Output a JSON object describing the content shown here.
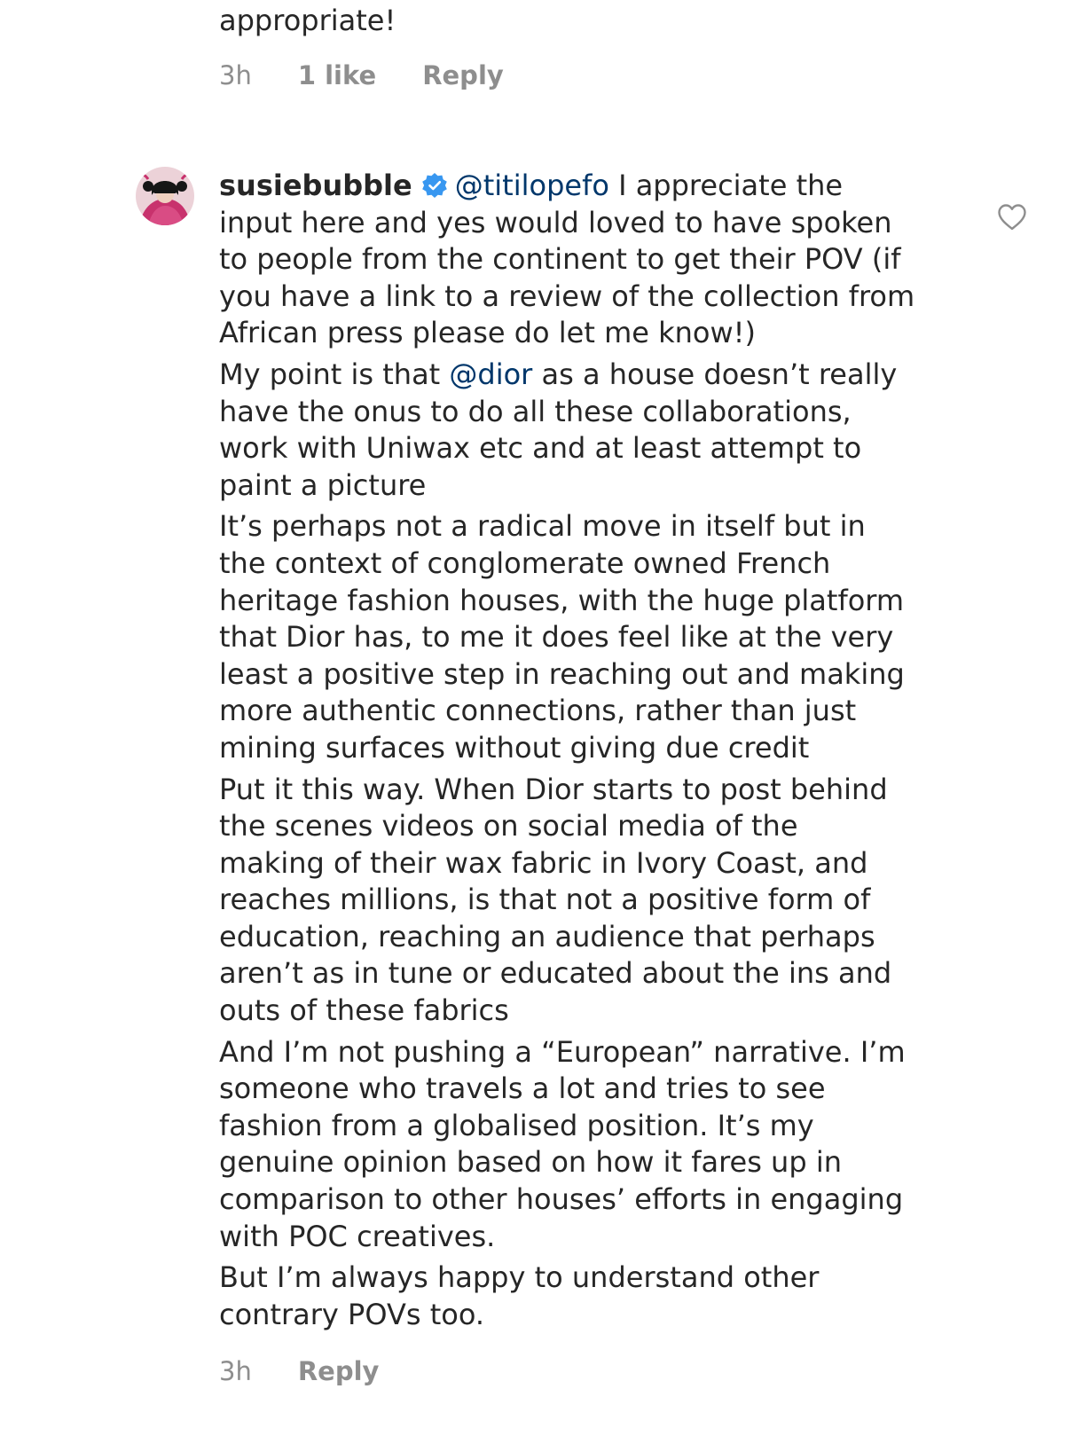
{
  "previous_comment": {
    "text_tail": "appropriate!",
    "time": "3h",
    "likes": "1 like",
    "reply_label": "Reply"
  },
  "comment": {
    "username": "susiebubble",
    "verified": true,
    "avatar_icon": "avatar-photo",
    "like_icon": "heart-outline-icon",
    "mention_1": "@titilopefo",
    "p1_text": " I appreciate the\ninput here and yes would loved to have spoken\nto people from the continent to get their POV (if\nyou have a link to a review of the collection from\nAfrican press please do let me know!)",
    "p2_before": "My point is that ",
    "mention_2": "@dior",
    "p2_after": " as a house doesn’t really\nhave the onus to do all these collaborations,\nwork with Uniwax etc and at least attempt to\npaint a picture",
    "p3": "It’s perhaps not a radical move in itself but in\nthe context of conglomerate owned French\nheritage fashion houses, with the huge platform\nthat Dior has, to me it does feel like at the very\nleast a positive step in reaching out and making\nmore authentic connections, rather than just\nmining surfaces without giving due credit",
    "p4": "Put it this way.  When Dior starts to post behind\nthe scenes videos on social media of the\nmaking of their wax fabric in Ivory Coast, and\nreaches millions, is that not a positive form of\neducation, reaching an audience that perhaps\naren’t as in tune or educated about the ins and\nouts of these fabrics",
    "p5": "And I’m not pushing a “European” narrative.  I’m\nsomeone who travels a lot and tries to see\nfashion from a globalised position.  It’s my\ngenuine opinion based on how it fares up in\ncomparison to other houses’ efforts in engaging\nwith POC creatives.",
    "p6": "But I’m always happy to understand other\ncontrary POVs too.",
    "time": "3h",
    "reply_label": "Reply"
  },
  "colors": {
    "text": "#262626",
    "meta": "#8e8e8e",
    "mention": "#00376b",
    "verified_badge": "#3897f0"
  }
}
